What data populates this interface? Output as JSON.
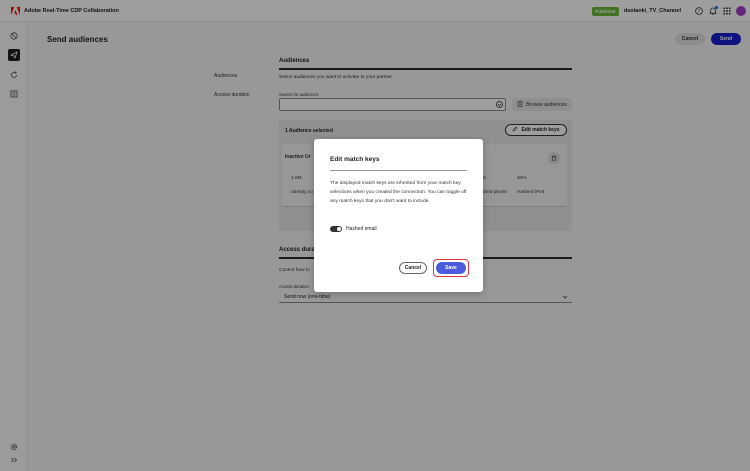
{
  "app": {
    "title": "Adobe Real-Time CDP Collaboration",
    "logo_icon": "adobe-logo-icon"
  },
  "topbar": {
    "role_badge": "Publisher",
    "org_name": "dsolanki_TV_Channel"
  },
  "rail": {
    "items": [
      "shield-icon",
      "send-icon",
      "refresh-icon",
      "audience-list-icon"
    ],
    "bottom": [
      "settings-icon",
      "expand-icon"
    ]
  },
  "page": {
    "title": "Send audiences",
    "cancel_label": "Cancel",
    "send_label": "Send"
  },
  "audiences": {
    "heading": "Audiences",
    "side_label": "Audiences",
    "description": "Select audiences you want to activate to your partner.",
    "access_duration_side_label": "Access duration",
    "search_label": "Search for audiences",
    "search_value": "",
    "browse_label": "Browse audiences",
    "selected_count": "1 Audience selected",
    "edit_match_keys_label": "Edit match keys",
    "card": {
      "name": "Inactive Ur",
      "size": "1.6M",
      "pct_a": "%",
      "pct_b": "34%",
      "identity_label": "Identity co",
      "key_a": "shed phone",
      "key_b": "Hashed IPv4"
    }
  },
  "access": {
    "heading": "Access durat",
    "description": "Control how lo",
    "field_label": "Access duration",
    "selected": "Send now (one-time)"
  },
  "modal": {
    "title": "Edit match keys",
    "body": "The displayed match keys are inherited from your match key selections when you created the connection. You can toggle off any match keys that you don't want to include.",
    "toggle_label": "Hashed email",
    "toggle_on": true,
    "cancel_label": "Cancel",
    "save_label": "Save"
  },
  "colors": {
    "accent": "#1a1ed1",
    "save": "#4b5bdc",
    "highlight": "#d7373f",
    "badge": "#6eb83b"
  }
}
